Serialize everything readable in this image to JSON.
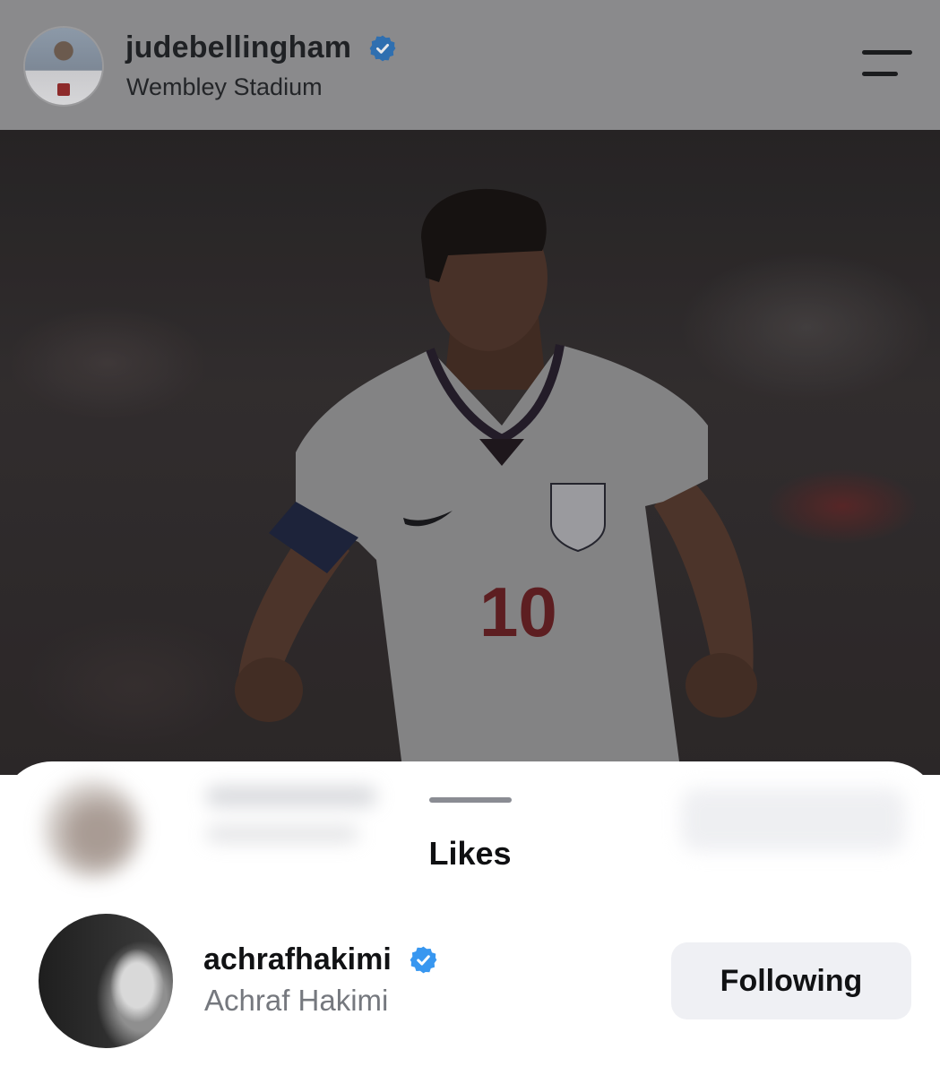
{
  "header": {
    "username": "judebellingham",
    "verified": true,
    "location": "Wembley Stadium"
  },
  "post": {
    "image_description_icon": "photo"
  },
  "likes_sheet": {
    "title": "Likes",
    "rows": [
      {
        "username": "achrafhakimi",
        "verified": true,
        "full_name": "Achraf Hakimi",
        "follow_state": "Following"
      }
    ]
  },
  "colors": {
    "verified_blue": "#3897f0",
    "header_dim": "#8a8a8c",
    "button_bg": "#eff0f4",
    "secondary_text": "#75787e"
  }
}
